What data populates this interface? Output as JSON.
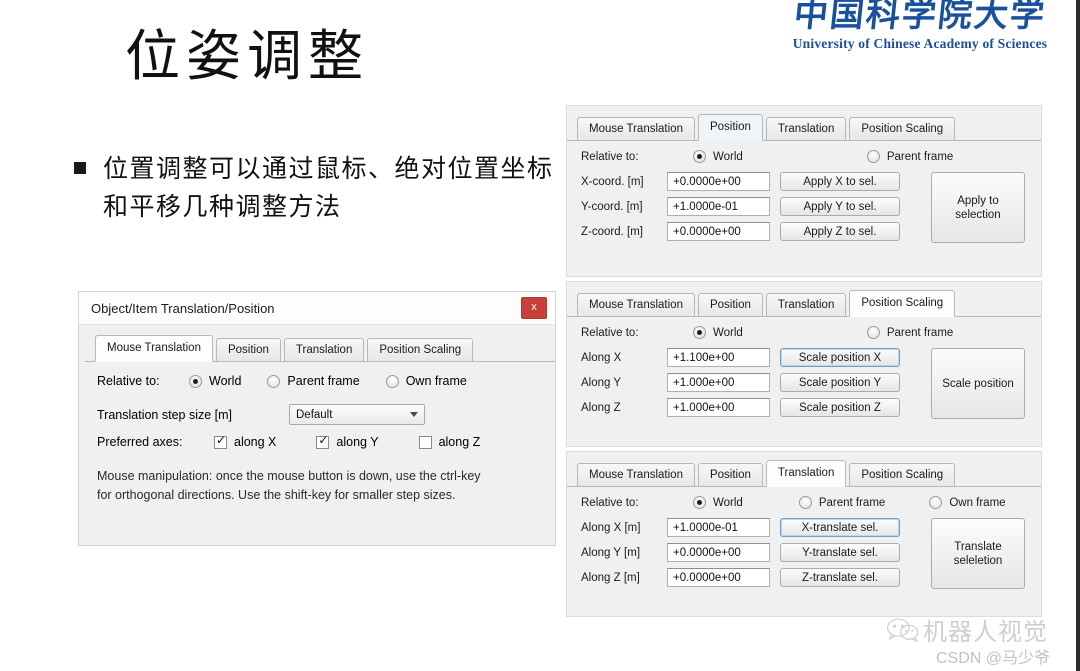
{
  "slide": {
    "title": "位姿调整",
    "bullet": "位置调整可以通过鼠标、绝对位置坐标和平移几种调整方法",
    "logo": {
      "cn": "中国科学院大学",
      "en": "University of  Chinese Academy of Sciences",
      "color": "#1d4e9c"
    },
    "watermark": {
      "icon": "wechat-icon",
      "text": "机器人视觉",
      "csdn": "CSDN @马少爷"
    }
  },
  "dialog": {
    "title": "Object/Item Translation/Position",
    "close_label": "x",
    "close_color": "#c8403a",
    "tabs": [
      {
        "label": "Mouse Translation",
        "active": true
      },
      {
        "label": "Position",
        "active": false
      },
      {
        "label": "Translation",
        "active": false
      },
      {
        "label": "Position Scaling",
        "active": false
      }
    ],
    "relative_label": "Relative to:",
    "relative_options": [
      {
        "label": "World",
        "selected": true
      },
      {
        "label": "Parent frame",
        "selected": false
      },
      {
        "label": "Own frame",
        "selected": false
      }
    ],
    "step_label": "Translation step size [m]",
    "step_value": "Default",
    "axes_label": "Preferred axes:",
    "axes": [
      {
        "label": "along X",
        "checked": true
      },
      {
        "label": "along Y",
        "checked": true
      },
      {
        "label": "along Z",
        "checked": false
      }
    ],
    "hint_line1": "Mouse manipulation: once the mouse button is down, use the ctrl-key",
    "hint_line2": "for orthogonal directions. Use the shift-key for smaller step sizes."
  },
  "panels": [
    {
      "id": "position-panel",
      "tabs": [
        {
          "label": "Mouse Translation",
          "active": false
        },
        {
          "label": "Position",
          "active": true
        },
        {
          "label": "Translation",
          "active": false
        },
        {
          "label": "Position Scaling",
          "active": false
        }
      ],
      "relative_label": "Relative to:",
      "relative_options": [
        {
          "label": "World",
          "selected": true
        },
        {
          "label": "Parent frame",
          "selected": false
        }
      ],
      "rows": [
        {
          "label": "X-coord. [m]",
          "value": "+0.0000e+00",
          "button": "Apply X to sel.",
          "focused": false
        },
        {
          "label": "Y-coord. [m]",
          "value": "+1.0000e-01",
          "button": "Apply Y to sel.",
          "focused": false
        },
        {
          "label": "Z-coord. [m]",
          "value": "+0.0000e+00",
          "button": "Apply Z to sel.",
          "focused": false
        }
      ],
      "side_button": "Apply to selection"
    },
    {
      "id": "position-scaling-panel",
      "tabs": [
        {
          "label": "Mouse Translation",
          "active": false
        },
        {
          "label": "Position",
          "active": false
        },
        {
          "label": "Translation",
          "active": false
        },
        {
          "label": "Position Scaling",
          "active": true
        }
      ],
      "relative_label": "Relative to:",
      "relative_options": [
        {
          "label": "World",
          "selected": true
        },
        {
          "label": "Parent frame",
          "selected": false
        }
      ],
      "rows": [
        {
          "label": "Along X",
          "value": "+1.100e+00",
          "button": "Scale position X",
          "focused": true
        },
        {
          "label": "Along Y",
          "value": "+1.000e+00",
          "button": "Scale position Y",
          "focused": false
        },
        {
          "label": "Along Z",
          "value": "+1.000e+00",
          "button": "Scale position Z",
          "focused": false
        }
      ],
      "side_button": "Scale position"
    },
    {
      "id": "translation-panel",
      "tabs": [
        {
          "label": "Mouse Translation",
          "active": false
        },
        {
          "label": "Position",
          "active": false
        },
        {
          "label": "Translation",
          "active": true
        },
        {
          "label": "Position Scaling",
          "active": false
        }
      ],
      "relative_label": "Relative to:",
      "relative_options": [
        {
          "label": "World",
          "selected": true
        },
        {
          "label": "Parent frame",
          "selected": false
        },
        {
          "label": "Own frame",
          "selected": false
        }
      ],
      "rows": [
        {
          "label": "Along X [m]",
          "value": "+1.0000e-01",
          "button": "X-translate sel.",
          "focused": true
        },
        {
          "label": "Along Y [m]",
          "value": "+0.0000e+00",
          "button": "Y-translate sel.",
          "focused": false
        },
        {
          "label": "Along Z [m]",
          "value": "+0.0000e+00",
          "button": "Z-translate sel.",
          "focused": false
        }
      ],
      "side_button": "Translate seleletion"
    }
  ]
}
